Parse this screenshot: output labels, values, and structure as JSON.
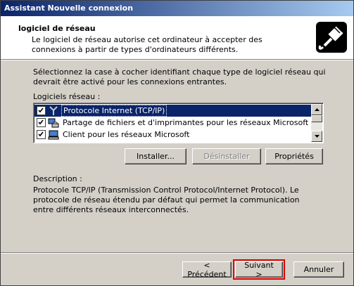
{
  "window": {
    "title": "Assistant Nouvelle connexion"
  },
  "header": {
    "title": "logiciel de réseau",
    "description": "Le logiciel de réseau autorise cet ordinateur à accepter des connexions à partir de types d'ordinateurs différents.",
    "icon": "network-cable-icon"
  },
  "intro": "Sélectionnez la case à cocher identifiant chaque type de logiciel réseau qui devrait être activé pour les connexions entrantes.",
  "list": {
    "label": "Logiciels réseau :",
    "items": [
      {
        "label": "Protocole Internet (TCP/IP)",
        "checked": true,
        "selected": true,
        "icon": "protocol-icon"
      },
      {
        "label": "Partage de fichiers et d'imprimantes pour les réseaux Microsoft",
        "checked": true,
        "selected": false,
        "icon": "file-printer-sharing-icon"
      },
      {
        "label": "Client pour les réseaux Microsoft",
        "checked": true,
        "selected": false,
        "icon": "network-client-icon"
      }
    ]
  },
  "buttons": {
    "install": "Installer...",
    "uninstall": "Désinstaller",
    "properties": "Propriétés",
    "back": "< Précédent",
    "next": "Suivant >",
    "cancel": "Annuler"
  },
  "description": {
    "label": "Description :",
    "text": "Protocole TCP/IP (Transmission Control Protocol/Internet Protocol). Le protocole de réseau étendu par défaut qui permet la communication entre différents réseaux interconnectés."
  },
  "colors": {
    "titlebar_start": "#0a246a",
    "titlebar_end": "#a6caf0",
    "selection": "#0a246a",
    "focus_highlight": "#e00000"
  }
}
